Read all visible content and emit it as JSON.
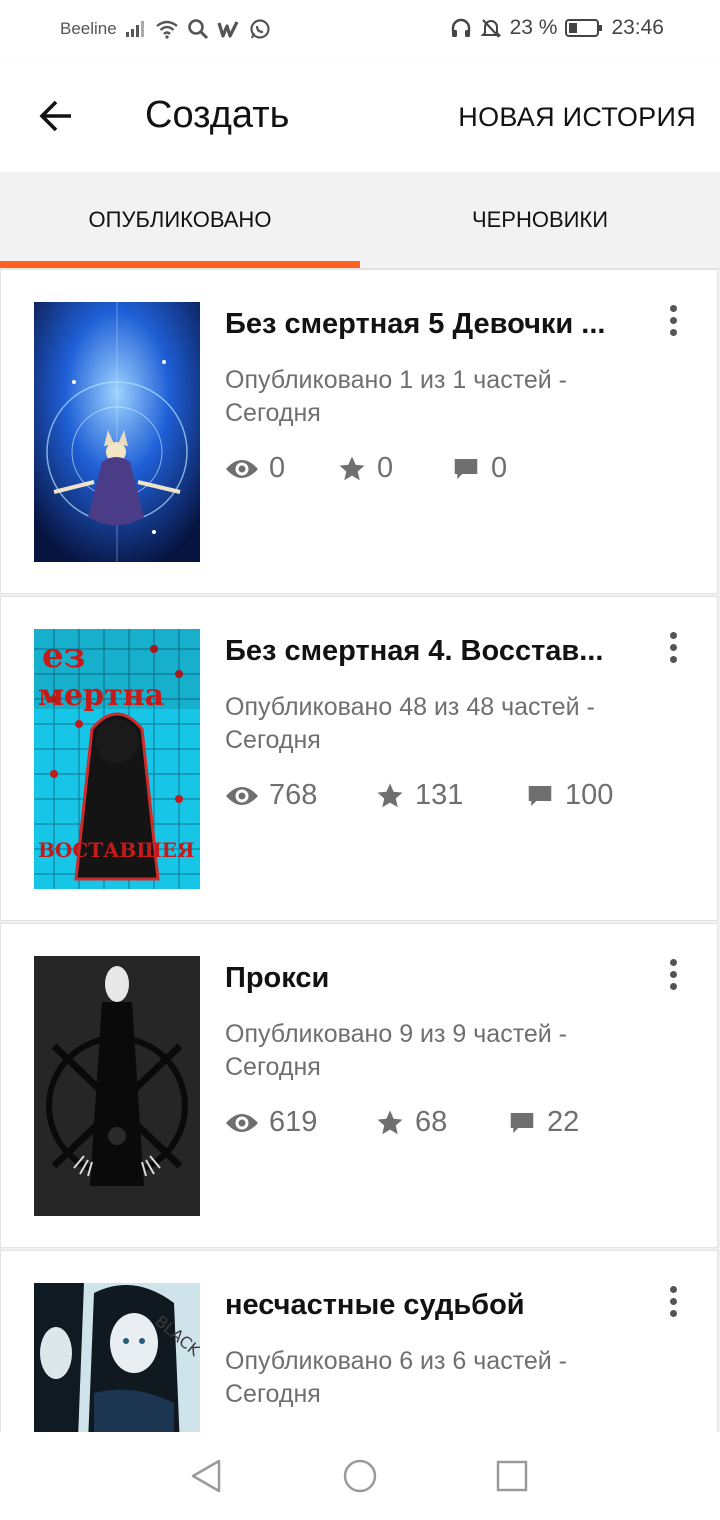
{
  "status_bar": {
    "carrier": "Beeline",
    "battery": "23 %",
    "time": "23:46"
  },
  "app_bar": {
    "title": "Создать",
    "new_story": "НОВАЯ ИСТОРИЯ"
  },
  "tabs": [
    {
      "label": "ОПУБЛИКОВАНО",
      "selected": true
    },
    {
      "label": "ЧЕРНОВИКИ",
      "selected": false
    }
  ],
  "stories": [
    {
      "title": "Без смертная 5 Девочки ...",
      "meta_line1": "Опубликовано 1 из 1 частей -",
      "meta_line2": "Сегодня",
      "views": "0",
      "votes": "0",
      "comments": "0",
      "cover_icon": "anime-girl-blue-cover"
    },
    {
      "title": "Без смертная 4. Восстав...",
      "meta_line1": "Опубликовано 48 из 48 частей -",
      "meta_line2": "Сегодня",
      "views": "768",
      "votes": "131",
      "comments": "100",
      "cover_icon": "red-grid-cover"
    },
    {
      "title": "Прокси",
      "meta_line1": "Опубликовано 9 из 9 частей -",
      "meta_line2": "Сегодня",
      "views": "619",
      "votes": "68",
      "comments": "22",
      "cover_icon": "dark-slender-cover"
    },
    {
      "title": "несчастные судьбой",
      "meta_line1": "Опубликовано 6 из 6 частей -",
      "meta_line2": "Сегодня",
      "cover_icon": "twins-cover"
    }
  ],
  "colors": {
    "accent": "#ff6122",
    "meta_text": "#6f6f6f"
  }
}
